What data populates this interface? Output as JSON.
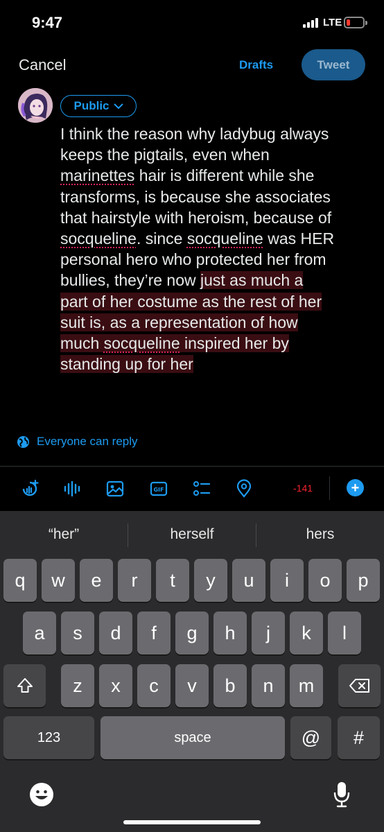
{
  "status_bar": {
    "time": "9:47",
    "network": "LTE"
  },
  "header": {
    "cancel": "Cancel",
    "drafts": "Drafts",
    "tweet": "Tweet"
  },
  "audience": {
    "label": "Public"
  },
  "tweet": {
    "lines": [
      [
        {
          "t": "I think the reason why ladybug always"
        }
      ],
      [
        {
          "t": "keeps the pigtails, even when"
        }
      ],
      [
        {
          "t": "marinettes",
          "sp": true
        },
        {
          "t": " hair is different while she"
        }
      ],
      [
        {
          "t": "transforms, is because she associates"
        }
      ],
      [
        {
          "t": "that hairstyle with heroism, because of"
        }
      ],
      [
        {
          "t": "socqueline",
          "sp": true
        },
        {
          "t": ". since "
        },
        {
          "t": "socqueline",
          "sp": true
        },
        {
          "t": " was HER"
        }
      ],
      [
        {
          "t": "personal hero who protected her from"
        }
      ],
      [
        {
          "t": "bullies, they’re now "
        },
        {
          "t": "just as much a",
          "ov": true
        }
      ],
      [
        {
          "t": "part of her costume as the rest of her",
          "ov": true
        }
      ],
      [
        {
          "t": "suit is, as a representation of how",
          "ov": true
        }
      ],
      [
        {
          "t": "much ",
          "ov": true
        },
        {
          "t": "socqueline",
          "sp": true,
          "ov": true
        },
        {
          "t": " inspired her by",
          "ov": true
        }
      ],
      [
        {
          "t": "standing up for her",
          "ov": true
        }
      ]
    ]
  },
  "reply_setting": {
    "label": "Everyone can reply"
  },
  "toolbar": {
    "char_counter": "-141"
  },
  "suggestions": [
    "“her”",
    "herself",
    "hers"
  ],
  "keyboard": {
    "row1": [
      "q",
      "w",
      "e",
      "r",
      "t",
      "y",
      "u",
      "i",
      "o",
      "p"
    ],
    "row2": [
      "a",
      "s",
      "d",
      "f",
      "g",
      "h",
      "j",
      "k",
      "l"
    ],
    "row3": [
      "z",
      "x",
      "c",
      "v",
      "b",
      "n",
      "m"
    ],
    "numbers_key": "123",
    "space_key": "space",
    "at_key": "@",
    "hash_key": "#"
  },
  "colors": {
    "accent": "#1d9bf0",
    "over_limit": "#f4212e",
    "over_limit_bg": "#3a0d12"
  }
}
